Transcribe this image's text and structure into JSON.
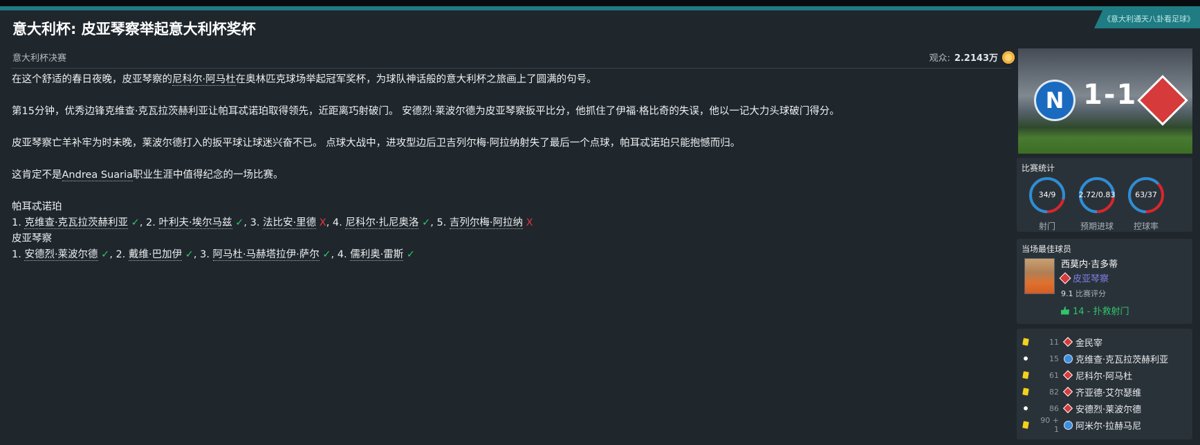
{
  "source_tag": "《意大利通天八卦看足球》",
  "headline": "意大利杯: 皮亚琴察举起意大利杯奖杯",
  "competition": "意大利杯决赛",
  "attendance": {
    "label": "观众:",
    "value": "2.2143万"
  },
  "article": {
    "p1": "在这个舒适的春日夜晚，皮亚琴察的",
    "p1_link": "尼科尔·阿马杜",
    "p1_end": "在奥林匹克球场举起冠军奖杯，为球队神话般的意大利杯之旅画上了圆满的句号。",
    "p2": "第15分钟，优秀边锋克维查·克瓦拉茨赫利亚让帕耳忒诺珀取得领先，近距离巧射破门。 安德烈·莱波尔德为皮亚琴察扳平比分，他抓住了伊福·格比奇的失误，他以一记大力头球破门得分。",
    "p3": "皮亚琴察亡羊补牢为时未晚，莱波尔德打入的扳平球让球迷兴奋不已。 点球大战中，进攻型边后卫吉列尔梅·阿拉纳射失了最后一个点球，帕耳忒诺珀只能抱憾而归。",
    "p4_pre": "这肯定不是",
    "p4_name": "Andrea Suaria",
    "p4_post": "职业生涯中值得纪念的一场比赛。"
  },
  "penalties": {
    "home_team": "帕耳忒诺珀",
    "home": [
      {
        "n": "1.",
        "name": "克维查·克瓦拉茨赫利亚",
        "mark": "✓",
        "scored": true
      },
      {
        "n": "2.",
        "name": "叶利夫·埃尔马兹",
        "mark": "✓",
        "scored": true
      },
      {
        "n": "3.",
        "name": "法比安·里德",
        "mark": "X",
        "scored": false
      },
      {
        "n": "4.",
        "name": "尼科尔·扎尼奥洛",
        "mark": "✓",
        "scored": true
      },
      {
        "n": "5.",
        "name": "吉列尔梅·阿拉纳",
        "mark": "X",
        "scored": false
      }
    ],
    "away_team": "皮亚琴察",
    "away": [
      {
        "n": "1.",
        "name": "安德烈·莱波尔德",
        "mark": "✓",
        "scored": true
      },
      {
        "n": "2.",
        "name": "戴维·巴加伊",
        "mark": "✓",
        "scored": true
      },
      {
        "n": "3.",
        "name": "阿马杜·马赫塔拉伊·萨尔",
        "mark": "✓",
        "scored": true
      },
      {
        "n": "4.",
        "name": "儒利奥·雷斯",
        "mark": "✓",
        "scored": true
      }
    ]
  },
  "score": {
    "home": "1",
    "sep": "-",
    "away": "1",
    "home_logo_letter": "N"
  },
  "stats": {
    "title": "比赛统计",
    "items": [
      {
        "value": "34/9",
        "label": "射门",
        "home_share": 0.79
      },
      {
        "value": "2.72/0.83",
        "label": "预期进球",
        "home_share": 0.77
      },
      {
        "value": "63/37",
        "label": "控球率",
        "home_share": 0.63
      }
    ],
    "colors": {
      "home": "#2a8fd6",
      "away": "#d8262c"
    }
  },
  "motm": {
    "title": "当场最佳球员",
    "name": "西莫内·吉多蒂",
    "club": "皮亚琴察",
    "rating_value": "9.1",
    "rating_label": "比赛评分",
    "highlight": "14 - 扑救射门"
  },
  "events": [
    {
      "icon": "yellow-card",
      "minute": "11",
      "team": "pal",
      "player": "金民宰"
    },
    {
      "icon": "goal",
      "minute": "15",
      "team": "nap",
      "player": "克维查·克瓦拉茨赫利亚"
    },
    {
      "icon": "yellow-card",
      "minute": "61",
      "team": "pal",
      "player": "尼科尔·阿马杜"
    },
    {
      "icon": "yellow-card",
      "minute": "82",
      "team": "pal",
      "player": "齐亚德·艾尔瑟维"
    },
    {
      "icon": "goal",
      "minute": "86",
      "team": "pal",
      "player": "安德烈·莱波尔德"
    },
    {
      "icon": "yellow-card",
      "minute": "90 + 1",
      "team": "nap",
      "player": "阿米尔·拉赫马尼"
    }
  ]
}
